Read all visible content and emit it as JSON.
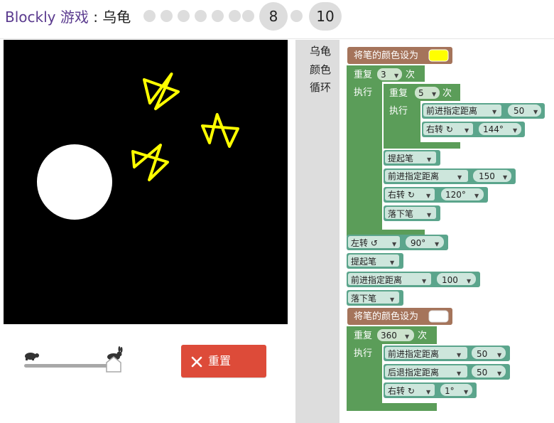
{
  "header": {
    "app_link": "Blockly 游戏",
    "separator": " : ",
    "game_name": "乌龟",
    "level_8": "8",
    "level_10": "10"
  },
  "colors": {
    "turtle_category": "#5b9d59",
    "pen_color_block": "#a5745b",
    "loop_block": "#5b9d59",
    "math_field": "#cde3cd",
    "stage_background": "#000000",
    "star_color": "#ffff00",
    "reset_button": "#dd4b39",
    "accent_link": "#5a3a8e"
  },
  "stage": {
    "content": "three yellow stars and one white circle on black"
  },
  "controls": {
    "speed_slow_icon": "turtle-icon",
    "speed_fast_icon": "rabbit-icon",
    "speed_level": 1.0,
    "reset_label": "重置"
  },
  "toolbox": {
    "categories": [
      "乌龟",
      "颜色",
      "循环"
    ]
  },
  "program": {
    "set_color_1": "将笔的颜色设为",
    "color_1": "#ffff00",
    "repeat_1": "重复",
    "repeat_1_count": "3",
    "times": "次",
    "do": "执行",
    "repeat_inner": "重复",
    "repeat_inner_count": "5",
    "inner_move": "前进指定距离",
    "inner_move_value": "50",
    "inner_turn": "右转 ↻",
    "inner_turn_value": "144°",
    "pen_up_1": "提起笔",
    "move_2": "前进指定距离",
    "move_2_value": "150",
    "turn_2": "右转 ↻",
    "turn_2_value": "120°",
    "pen_down_1": "落下笔",
    "turn_left": "左转 ↺",
    "turn_left_value": "90°",
    "pen_up_2": "提起笔",
    "move_3": "前进指定距离",
    "move_3_value": "100",
    "pen_down_2": "落下笔",
    "set_color_2": "将笔的颜色设为",
    "color_2": "#ffffff",
    "repeat_2": "重复",
    "repeat_2_count": "360",
    "move_4": "前进指定距离",
    "move_4_value": "50",
    "back_4": "后退指定距离",
    "back_4_value": "50",
    "turn_4": "右转 ↻",
    "turn_4_value": "1°"
  }
}
